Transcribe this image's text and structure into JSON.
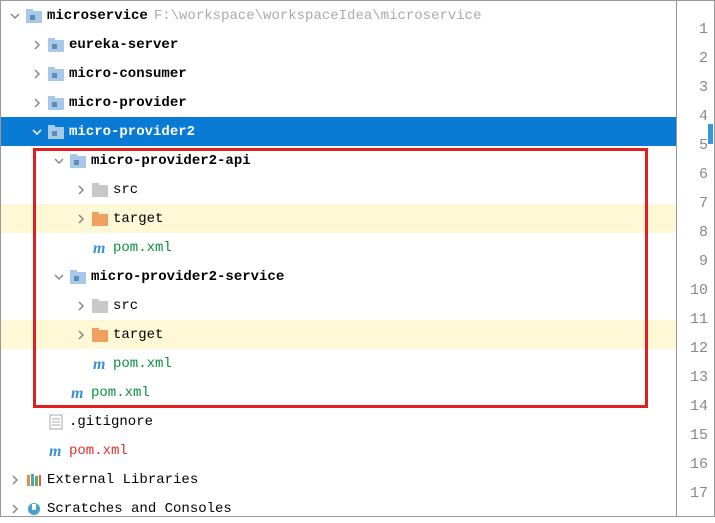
{
  "root": {
    "name": "microservice",
    "path": "F:\\workspace\\workspaceIdea\\microservice"
  },
  "tree": {
    "eureka_server": "eureka-server",
    "micro_consumer": "micro-consumer",
    "micro_provider": "micro-provider",
    "micro_provider2": "micro-provider2",
    "mp2_api": "micro-provider2-api",
    "mp2_api_src": "src",
    "mp2_api_target": "target",
    "mp2_api_pom": "pom.xml",
    "mp2_service": "micro-provider2-service",
    "mp2_service_src": "src",
    "mp2_service_target": "target",
    "mp2_service_pom": "pom.xml",
    "mp2_pom": "pom.xml",
    "gitignore": ".gitignore",
    "root_pom": "pom.xml",
    "ext_libs": "External Libraries",
    "scratches": "Scratches and Consoles"
  },
  "gutter": [
    "1",
    "2",
    "3",
    "4",
    "5",
    "6",
    "7",
    "8",
    "9",
    "10",
    "11",
    "12",
    "13",
    "14",
    "15",
    "16",
    "17"
  ]
}
